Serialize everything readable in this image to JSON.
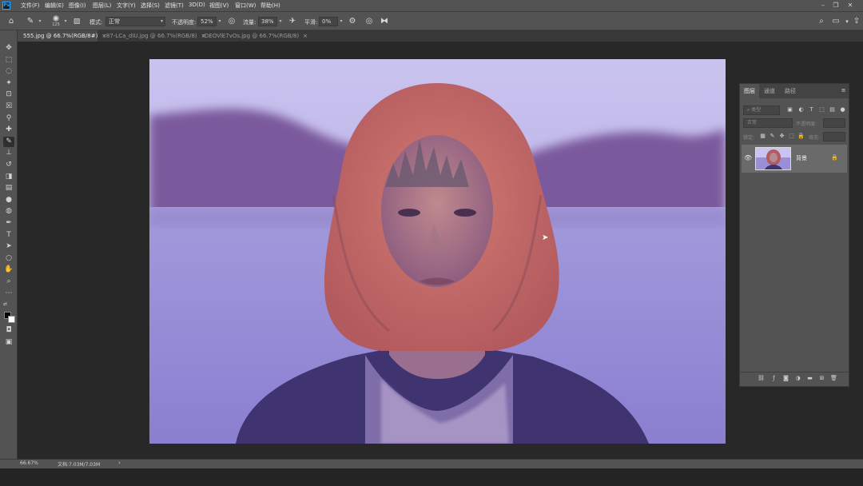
{
  "app": {
    "logo_text": "Ps"
  },
  "menubar": {
    "items": [
      "文件(F)",
      "编辑(E)",
      "图像(I)",
      "图层(L)",
      "文字(Y)",
      "选择(S)",
      "滤镜(T)",
      "3D(D)",
      "视图(V)",
      "窗口(W)",
      "帮助(H)"
    ],
    "window_controls": {
      "minimize": "–",
      "restore": "❐",
      "close": "✕"
    }
  },
  "options_bar": {
    "brush_size": "125",
    "mode_label": "模式:",
    "mode_value": "正常",
    "opacity_label": "不透明度:",
    "opacity_value": "52%",
    "flow_label": "流量:",
    "flow_value": "38%",
    "smoothing_label": "平滑:",
    "smoothing_value": "0%"
  },
  "tabs": [
    {
      "label": "555.jpg @ 66.7%(RGB/8#)",
      "active": true
    },
    {
      "label": "r87-LCa_dIU.jpg @ 66.7%(RGB/8)",
      "active": false
    },
    {
      "label": "rDEOVlE7vOs.jpg @ 66.7%(RGB/8)",
      "active": false
    }
  ],
  "tab_close_glyph": "×",
  "tools": [
    "move-tool",
    "marquee-tool",
    "lasso-tool",
    "magic-wand-tool",
    "crop-tool",
    "frame-tool",
    "eyedropper-tool",
    "healing-brush-tool",
    "brush-tool",
    "clone-stamp-tool",
    "history-brush-tool",
    "eraser-tool",
    "gradient-tool",
    "blur-tool",
    "dodge-tool",
    "pen-tool",
    "type-tool",
    "path-selection-tool",
    "shape-tool",
    "hand-tool",
    "zoom-tool",
    "more-tools"
  ],
  "active_tool": "brush-tool",
  "colors": {
    "foreground": "#000000",
    "background": "#ffffff",
    "accent": "#31a8ff",
    "sky": "#c9c3ef",
    "mountain": "#7a5a9c",
    "water": "#8a7fd0",
    "hair": "#b35a5e",
    "shirt": "#3f3470"
  },
  "layers_panel": {
    "tabs": [
      "图层",
      "通道",
      "路径"
    ],
    "active_tab": "图层",
    "filter_placeholder": "类型",
    "blend_mode": "正常",
    "opacity_label": "不透明度:",
    "lock_label": "锁定:",
    "fill_label": "填充:",
    "layers": [
      {
        "name": "背景",
        "visible": true,
        "locked": true
      }
    ]
  },
  "statusbar": {
    "zoom": "66.67%",
    "doc_info": "文档:7.03M/7.03M",
    "arrow": "›"
  }
}
